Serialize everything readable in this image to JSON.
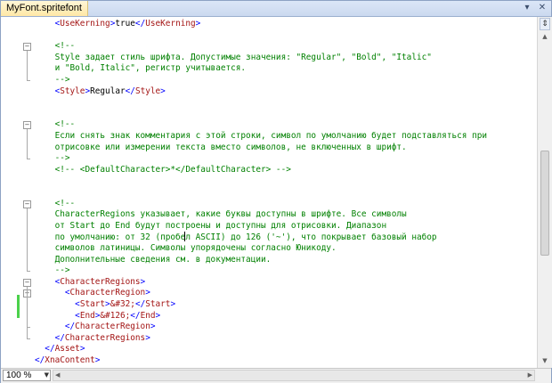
{
  "document": {
    "tab_title": "MyFont.spritefont",
    "dropdown_icon": "chevron-down-icon",
    "close_icon": "close-icon"
  },
  "editor": {
    "lines": [
      [
        [
          "    ",
          "text"
        ],
        [
          "<",
          "br"
        ],
        [
          "UseKerning",
          "tag"
        ],
        [
          ">",
          "br"
        ],
        [
          "true",
          "text"
        ],
        [
          "</",
          "br"
        ],
        [
          "UseKerning",
          "tag"
        ],
        [
          ">",
          "br"
        ]
      ],
      [],
      [
        [
          "    <!--",
          "comment"
        ]
      ],
      [
        [
          "    Style задает стиль шрифта. Допустимые значения: \"Regular\", \"Bold\", \"Italic\"",
          "comment"
        ]
      ],
      [
        [
          "    и \"Bold, Italic\", регистр учитывается.",
          "comment"
        ]
      ],
      [
        [
          "    -->",
          "comment"
        ]
      ],
      [
        [
          "    ",
          "text"
        ],
        [
          "<",
          "br"
        ],
        [
          "Style",
          "tag"
        ],
        [
          ">",
          "br"
        ],
        [
          "Regular",
          "text"
        ],
        [
          "</",
          "br"
        ],
        [
          "Style",
          "tag"
        ],
        [
          ">",
          "br"
        ]
      ],
      [],
      [],
      [
        [
          "    <!--",
          "comment"
        ]
      ],
      [
        [
          "    Если снять знак комментария с этой строки, символ по умолчанию будет подставляться при",
          "comment"
        ]
      ],
      [
        [
          "    отрисовке или измерении текста вместо символов, не включенных в шрифт.",
          "comment"
        ]
      ],
      [
        [
          "    -->",
          "comment"
        ]
      ],
      [
        [
          "    <!-- <DefaultCharacter>*</DefaultCharacter> -->",
          "comment"
        ]
      ],
      [],
      [],
      [
        [
          "    <!--",
          "comment"
        ]
      ],
      [
        [
          "    CharacterRegions указывает, какие буквы доступны в шрифте. Все символы",
          "comment"
        ]
      ],
      [
        [
          "    от Start до End будут построены и доступны для отрисовки. Диапазон",
          "comment"
        ]
      ],
      [
        [
          "    по умолчанию: от 32 (пробе",
          "comment"
        ],
        [
          "",
          "caret"
        ],
        [
          "л ASCII) до 126 ('~'), что покрывает базовый набор",
          "comment"
        ]
      ],
      [
        [
          "    символов латиницы. Символы упорядочены согласно Юникоду.",
          "comment"
        ]
      ],
      [
        [
          "    Дополнительные сведения см. в документации.",
          "comment"
        ]
      ],
      [
        [
          "    -->",
          "comment"
        ]
      ],
      [
        [
          "    ",
          "text"
        ],
        [
          "<",
          "br"
        ],
        [
          "CharacterRegions",
          "tag"
        ],
        [
          ">",
          "br"
        ]
      ],
      [
        [
          "      ",
          "text"
        ],
        [
          "<",
          "br"
        ],
        [
          "CharacterRegion",
          "tag"
        ],
        [
          ">",
          "br"
        ]
      ],
      [
        [
          "        ",
          "text"
        ],
        [
          "<",
          "br"
        ],
        [
          "Start",
          "tag"
        ],
        [
          ">",
          "br"
        ],
        [
          "&#32;",
          "tag"
        ],
        [
          "</",
          "br"
        ],
        [
          "Start",
          "tag"
        ],
        [
          ">",
          "br"
        ]
      ],
      [
        [
          "        ",
          "text"
        ],
        [
          "<",
          "br"
        ],
        [
          "End",
          "tag"
        ],
        [
          ">",
          "br"
        ],
        [
          "&#126;",
          "tag"
        ],
        [
          "</",
          "br"
        ],
        [
          "End",
          "tag"
        ],
        [
          ">",
          "br"
        ]
      ],
      [
        [
          "      ",
          "text"
        ],
        [
          "</",
          "br"
        ],
        [
          "CharacterRegion",
          "tag"
        ],
        [
          ">",
          "br"
        ]
      ],
      [
        [
          "    ",
          "text"
        ],
        [
          "</",
          "br"
        ],
        [
          "CharacterRegions",
          "tag"
        ],
        [
          ">",
          "br"
        ]
      ],
      [
        [
          "  ",
          "text"
        ],
        [
          "</",
          "br"
        ],
        [
          "Asset",
          "tag"
        ],
        [
          ">",
          "br"
        ]
      ],
      [
        [
          "",
          "text"
        ],
        [
          "</",
          "br"
        ],
        [
          "XnaContent",
          "tag"
        ],
        [
          ">",
          "br"
        ]
      ]
    ],
    "folds": [
      2,
      9,
      16,
      23,
      24
    ]
  },
  "status": {
    "zoom": "100 %"
  },
  "colors": {
    "comment": "#008000",
    "tag": "#a31515",
    "bracket": "#0000ff",
    "text": "#000000",
    "change_marker": "#4bd14b"
  }
}
